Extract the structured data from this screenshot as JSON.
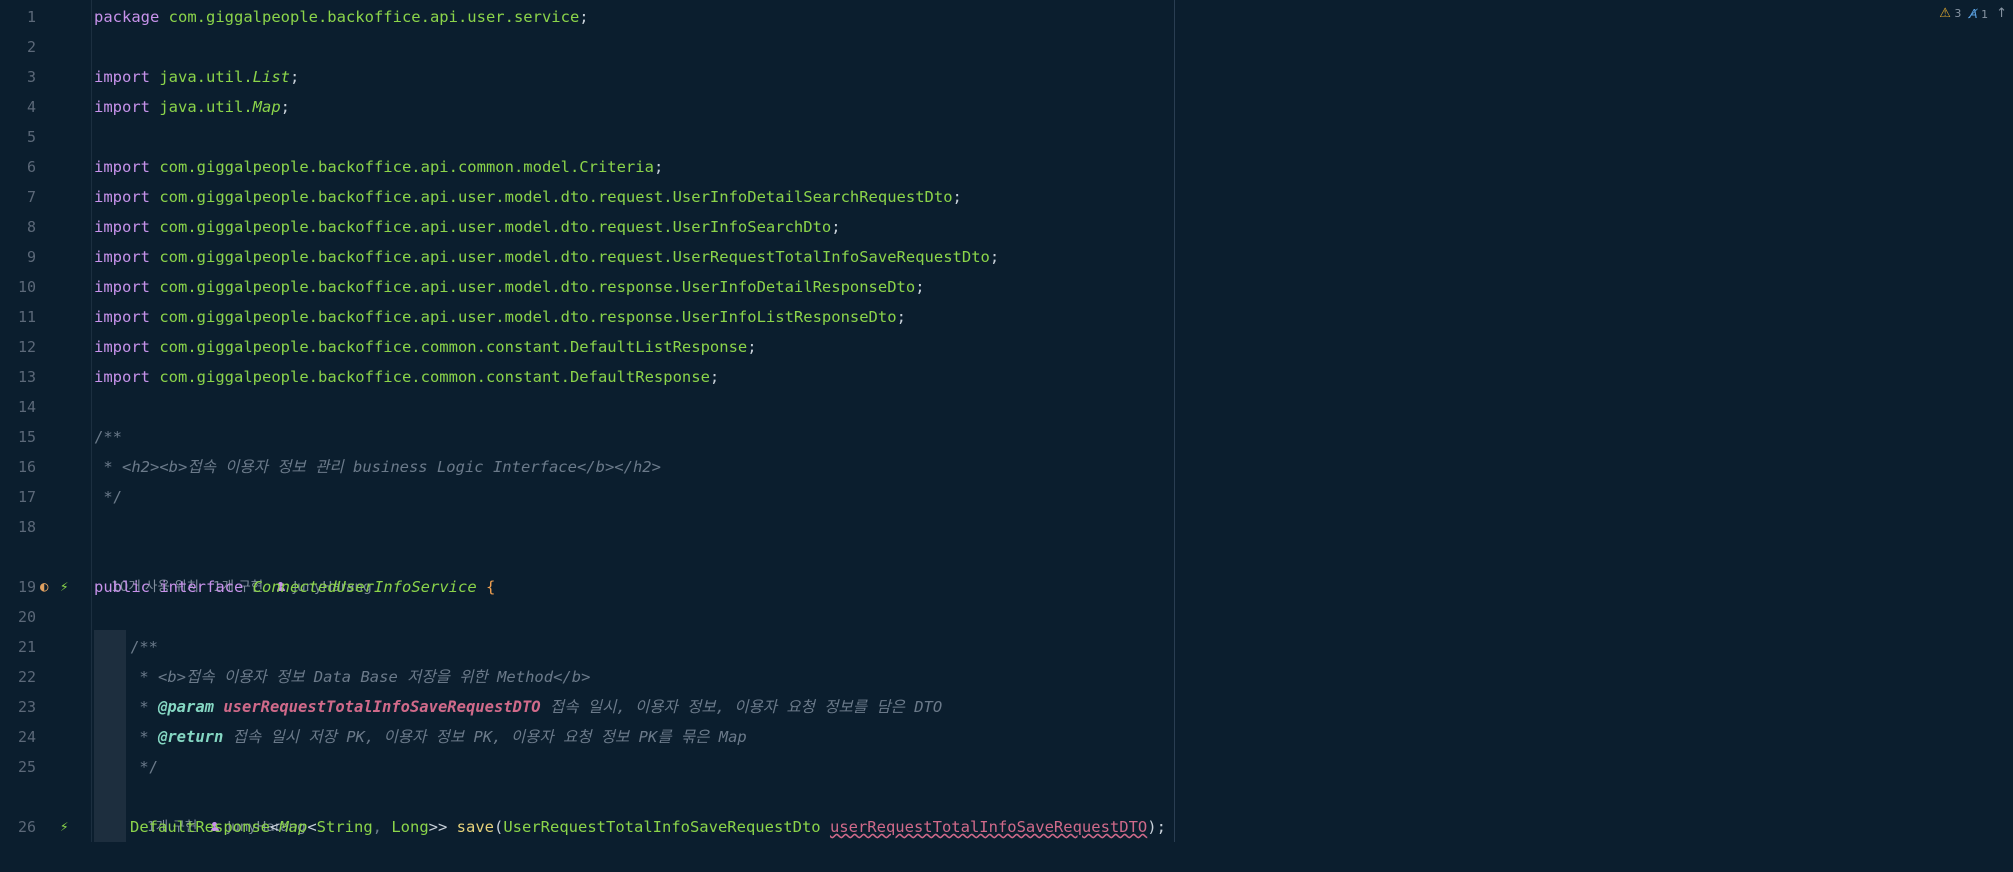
{
  "status": {
    "warnings": "3",
    "typos": "1"
  },
  "gutter": [
    "1",
    "2",
    "3",
    "4",
    "5",
    "6",
    "7",
    "8",
    "9",
    "10",
    "11",
    "12",
    "13",
    "14",
    "15",
    "16",
    "17",
    "18",
    "19",
    "20",
    "21",
    "22",
    "23",
    "24",
    "25",
    "26"
  ],
  "lines": {
    "l1": {
      "kw": "package",
      "pkg": "com.giggalpeople.backoffice.api.user.service",
      "end": ";"
    },
    "l3": {
      "kw": "import",
      "pkg": "java.util.",
      "cls": "List",
      "end": ";"
    },
    "l4": {
      "kw": "import",
      "pkg": "java.util.",
      "cls": "Map",
      "end": ";"
    },
    "l6": {
      "kw": "import",
      "pkg": "com.giggalpeople.backoffice.api.common.model.Criteria",
      "end": ";"
    },
    "l7": {
      "kw": "import",
      "pkg": "com.giggalpeople.backoffice.api.user.model.dto.request.UserInfoDetailSearchRequestDto",
      "end": ";"
    },
    "l8": {
      "kw": "import",
      "pkg": "com.giggalpeople.backoffice.api.user.model.dto.request.UserInfoSearchDto",
      "end": ";"
    },
    "l9": {
      "kw": "import",
      "pkg": "com.giggalpeople.backoffice.api.user.model.dto.request.UserRequestTotalInfoSaveRequestDto",
      "end": ";"
    },
    "l10": {
      "kw": "import",
      "pkg": "com.giggalpeople.backoffice.api.user.model.dto.response.UserInfoDetailResponseDto",
      "end": ";"
    },
    "l11": {
      "kw": "import",
      "pkg": "com.giggalpeople.backoffice.api.user.model.dto.response.UserInfoListResponseDto",
      "end": ";"
    },
    "l12": {
      "kw": "import",
      "pkg": "com.giggalpeople.backoffice.common.constant.DefaultListResponse",
      "end": ";"
    },
    "l13": {
      "kw": "import",
      "pkg": "com.giggalpeople.backoffice.common.constant.DefaultResponse",
      "end": ";"
    },
    "l15": "/**",
    "l16": " * <h2><b>접속 이용자 정보 관리 business Logic Interface</b></h2>",
    "l17": " */",
    "l19": {
      "kw1": "public",
      "kw2": "interface",
      "name": "ConnectedUserInfoService",
      "brace": "{"
    },
    "l21": "/**",
    "l22": " * <b>접속 이용자 정보 Data Base 저장을 위한 Method</b>",
    "l23": {
      "prefix": " * ",
      "tag": "@param",
      "param": "userRequestTotalInfoSaveRequestDTO",
      "desc": " 접속 일시, 이용자 정보, 이용자 요청 정보를 담은 DTO"
    },
    "l24": {
      "prefix": " * ",
      "tag": "@return",
      "desc": " 접속 일시 저장 PK, 이용자 정보 PK, 이용자 요청 정보 PK를 묶은 Map"
    },
    "l25": " */",
    "l26": {
      "ret1": "DefaultResponse",
      "lt1": "<",
      "ret2": "Map",
      "lt2": "<",
      "t1": "String",
      "comma": ", ",
      "t2": "Long",
      "gt": ">> ",
      "method": "save",
      "lp": "(",
      "ptype": "UserRequestTotalInfoSaveRequestDto",
      "sp": " ",
      "pname": "userRequestTotalInfoSaveRequestDTO",
      "rp": ");"
    }
  },
  "inlays": {
    "class_usages": "10개 사용 위치",
    "class_impl": "1개 구현",
    "class_author": "JunyHarang",
    "method_impl": "1개 구현",
    "method_author": "JunyHarang"
  },
  "colors": {
    "background": "#0b1e2e",
    "keyword": "#c792ea",
    "package": "#8bd44a",
    "comment": "#6b7a8a"
  }
}
